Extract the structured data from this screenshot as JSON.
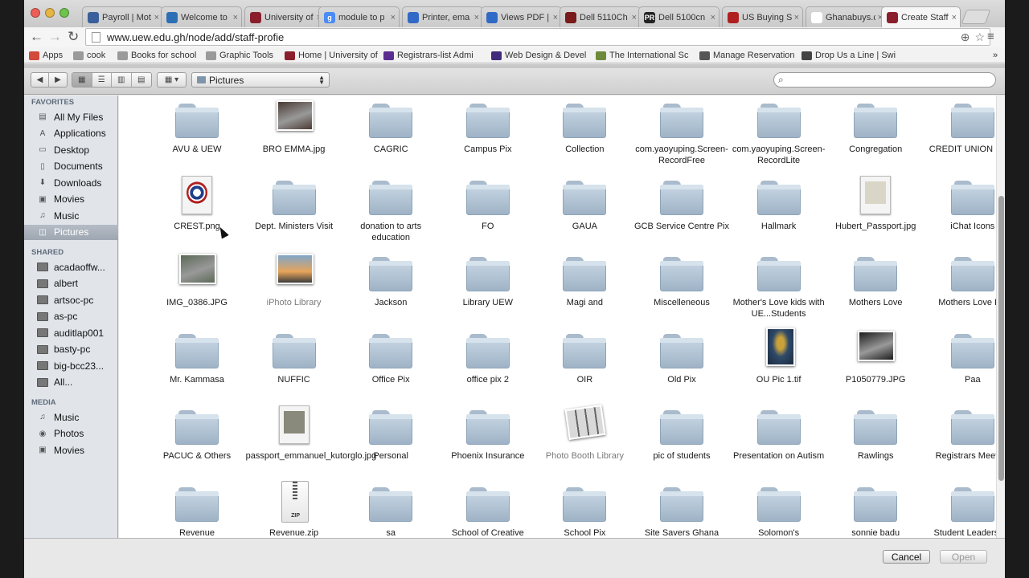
{
  "browser": {
    "tabs": [
      {
        "title": "Payroll | Mot",
        "active": false
      },
      {
        "title": "Welcome to",
        "active": false
      },
      {
        "title": "University of",
        "active": false
      },
      {
        "title": "module to p",
        "active": false
      },
      {
        "title": "Printer, ema",
        "active": false
      },
      {
        "title": "Views PDF |",
        "active": false
      },
      {
        "title": "Dell 5110Ch",
        "active": false
      },
      {
        "title": "Dell 5100cn",
        "active": false
      },
      {
        "title": "US Buying S",
        "active": false
      },
      {
        "title": "Ghanabuys.c",
        "active": false
      },
      {
        "title": "Create Staff",
        "active": true
      }
    ],
    "url": "www.uew.edu.gh/node/add/staff-profie",
    "bookmarks": [
      {
        "label": "Apps",
        "icon": "apps-grid-icon"
      },
      {
        "label": "cook",
        "icon": "folder-icon"
      },
      {
        "label": "Books for school",
        "icon": "folder-icon"
      },
      {
        "label": "Graphic Tools",
        "icon": "folder-icon"
      },
      {
        "label": "Home | University of",
        "icon": "uew-crest-icon"
      },
      {
        "label": "Registrars-list Admi",
        "icon": "yahoo-icon"
      },
      {
        "label": "Web Design & Devel",
        "icon": "w-icon"
      },
      {
        "label": "The International Sc",
        "icon": "leaf-icon"
      },
      {
        "label": "Manage Reservation",
        "icon": "plane-icon"
      },
      {
        "label": "Drop Us a Line | Swi",
        "icon": "sb-icon"
      }
    ],
    "bookmarks_overflow": "»"
  },
  "dialog": {
    "location": "Pictures",
    "search_placeholder": "",
    "cancel_label": "Cancel",
    "open_label": "Open"
  },
  "sidebar": {
    "favorites_heading": "FAVORITES",
    "favorites": [
      {
        "label": "All My Files",
        "icon": "all-files-icon"
      },
      {
        "label": "Applications",
        "icon": "applications-icon"
      },
      {
        "label": "Desktop",
        "icon": "desktop-icon"
      },
      {
        "label": "Documents",
        "icon": "documents-icon"
      },
      {
        "label": "Downloads",
        "icon": "downloads-icon"
      },
      {
        "label": "Movies",
        "icon": "movies-icon"
      },
      {
        "label": "Music",
        "icon": "music-icon"
      },
      {
        "label": "Pictures",
        "icon": "pictures-icon",
        "selected": true
      }
    ],
    "shared_heading": "SHARED",
    "shared": [
      "acadaoffw...",
      "albert",
      "artsoc-pc",
      "as-pc",
      "auditlap001",
      "basty-pc",
      "big-bcc23...",
      "All..."
    ],
    "media_heading": "MEDIA",
    "media": [
      {
        "label": "Music",
        "icon": "music-icon"
      },
      {
        "label": "Photos",
        "icon": "camera-icon"
      },
      {
        "label": "Movies",
        "icon": "movies-icon"
      }
    ]
  },
  "files": [
    {
      "name": "AVU & UEW",
      "kind": "folder"
    },
    {
      "name": "BRO EMMA.jpg",
      "kind": "image",
      "color": "#4a3a34"
    },
    {
      "name": "CAGRIC",
      "kind": "folder"
    },
    {
      "name": "Campus Pix",
      "kind": "folder"
    },
    {
      "name": "Collection",
      "kind": "folder"
    },
    {
      "name": "com.yaoyuping.Screen-RecordFree",
      "kind": "folder"
    },
    {
      "name": "com.yaoyuping.Screen-RecordLite",
      "kind": "folder"
    },
    {
      "name": "Congregation",
      "kind": "folder"
    },
    {
      "name": "CREDIT UNION PICS",
      "kind": "folder"
    },
    {
      "name": "CREST.png",
      "kind": "crest"
    },
    {
      "name": "Dept. Ministers Visit",
      "kind": "folder"
    },
    {
      "name": "donation to arts education",
      "kind": "folder"
    },
    {
      "name": "FO",
      "kind": "folder"
    },
    {
      "name": "GAUA",
      "kind": "folder"
    },
    {
      "name": "GCB Service Centre Pix",
      "kind": "folder"
    },
    {
      "name": "Hallmark",
      "kind": "folder"
    },
    {
      "name": "Hubert_Passport.jpg",
      "kind": "document",
      "color": "#d9d6c8"
    },
    {
      "name": "iChat Icons",
      "kind": "folder"
    },
    {
      "name": "IMG_0386.JPG",
      "kind": "image",
      "color": "#5c6a58"
    },
    {
      "name": "iPhoto Library",
      "kind": "iphoto",
      "dim": true
    },
    {
      "name": "Jackson",
      "kind": "folder"
    },
    {
      "name": "Library UEW",
      "kind": "folder"
    },
    {
      "name": "Magi and",
      "kind": "folder"
    },
    {
      "name": "Miscelleneous",
      "kind": "folder"
    },
    {
      "name": "Mother's Love kids with UE...Students",
      "kind": "folder"
    },
    {
      "name": "Mothers Love",
      "kind": "folder"
    },
    {
      "name": "Mothers Love Pix",
      "kind": "folder"
    },
    {
      "name": "Mr. Kammasa",
      "kind": "folder"
    },
    {
      "name": "NUFFIC",
      "kind": "folder"
    },
    {
      "name": "Office Pix",
      "kind": "folder"
    },
    {
      "name": "office pix 2",
      "kind": "folder"
    },
    {
      "name": "OIR",
      "kind": "folder"
    },
    {
      "name": "Old Pix",
      "kind": "folder"
    },
    {
      "name": "OU Pic 1.tif",
      "kind": "portrait",
      "color": "#2f4a6a"
    },
    {
      "name": "P1050779.JPG",
      "kind": "image",
      "color": "#1c1c1c"
    },
    {
      "name": "Paa",
      "kind": "folder"
    },
    {
      "name": "PACUC & Others",
      "kind": "folder"
    },
    {
      "name": "passport_emmanuel_kutorglo.jpg",
      "kind": "document",
      "color": "#8a8a7c"
    },
    {
      "name": "Personal",
      "kind": "folder"
    },
    {
      "name": "Phoenix Insurance",
      "kind": "folder"
    },
    {
      "name": "Photo Booth Library",
      "kind": "photobooth",
      "dim": true
    },
    {
      "name": "pic of students",
      "kind": "folder"
    },
    {
      "name": "Presentation on Autism",
      "kind": "folder"
    },
    {
      "name": "Rawlings",
      "kind": "folder"
    },
    {
      "name": "Registrars Meeting",
      "kind": "folder"
    },
    {
      "name": "Revenue",
      "kind": "folder"
    },
    {
      "name": "Revenue.zip",
      "kind": "zip"
    },
    {
      "name": "sa",
      "kind": "folder"
    },
    {
      "name": "School of Creative",
      "kind": "folder"
    },
    {
      "name": "School Pix",
      "kind": "folder"
    },
    {
      "name": "Site Savers Ghana",
      "kind": "folder"
    },
    {
      "name": "Solomon's",
      "kind": "folder"
    },
    {
      "name": "sonnie badu",
      "kind": "folder"
    },
    {
      "name": "Student Leaders trn",
      "kind": "folder"
    }
  ],
  "colors": {
    "selection": "#a7afba",
    "folder": "#b3c6d7"
  }
}
